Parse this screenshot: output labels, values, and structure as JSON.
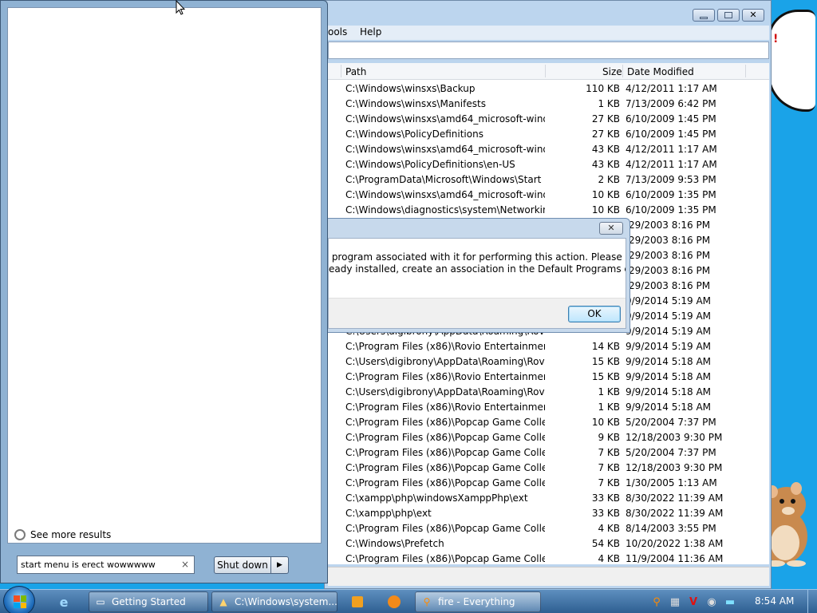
{
  "everything_window": {
    "menu_items": [
      "ools",
      "Help"
    ],
    "columns": {
      "path": "Path",
      "size": "Size",
      "date": "Date Modified"
    },
    "rows": [
      {
        "path": "C:\\Windows\\winsxs\\Backup",
        "size": "110 KB",
        "date": "4/12/2011 1:17 AM"
      },
      {
        "path": "C:\\Windows\\winsxs\\Manifests",
        "size": "1 KB",
        "date": "7/13/2009 6:42 PM"
      },
      {
        "path": "C:\\Windows\\winsxs\\amd64_microsoft-windo...",
        "size": "27 KB",
        "date": "6/10/2009 1:45 PM"
      },
      {
        "path": "C:\\Windows\\PolicyDefinitions",
        "size": "27 KB",
        "date": "6/10/2009 1:45 PM"
      },
      {
        "path": "C:\\Windows\\winsxs\\amd64_microsoft-windo...",
        "size": "43 KB",
        "date": "4/12/2011 1:17 AM"
      },
      {
        "path": "C:\\Windows\\PolicyDefinitions\\en-US",
        "size": "43 KB",
        "date": "4/12/2011 1:17 AM"
      },
      {
        "path": "C:\\ProgramData\\Microsoft\\Windows\\Start M...",
        "size": "2 KB",
        "date": "7/13/2009 9:53 PM"
      },
      {
        "path": "C:\\Windows\\winsxs\\amd64_microsoft-windo...",
        "size": "10 KB",
        "date": "6/10/2009 1:35 PM"
      },
      {
        "path": "C:\\Windows\\diagnostics\\system\\Networking",
        "size": "10 KB",
        "date": "6/10/2009 1:35 PM"
      },
      {
        "path": "",
        "size": "",
        "date": "/29/2003 8:16 PM"
      },
      {
        "path": "",
        "size": "",
        "date": "/29/2003 8:16 PM"
      },
      {
        "path": "",
        "size": "",
        "date": "/29/2003 8:16 PM"
      },
      {
        "path": "",
        "size": "",
        "date": "/29/2003 8:16 PM"
      },
      {
        "path": "",
        "size": "",
        "date": "/29/2003 8:16 PM"
      },
      {
        "path": "",
        "size": "",
        "date": "9/9/2014 5:19 AM"
      },
      {
        "path": "",
        "size": "",
        "date": "9/9/2014 5:19 AM"
      },
      {
        "path": "C:\\Users\\digibrony\\AppData\\Roaming\\Rovio...",
        "size": "",
        "date": "9/9/2014 5:19 AM"
      },
      {
        "path": "C:\\Program Files (x86)\\Rovio Entertainment L...",
        "size": "14 KB",
        "date": "9/9/2014 5:19 AM"
      },
      {
        "path": "C:\\Users\\digibrony\\AppData\\Roaming\\Rovio...",
        "size": "15 KB",
        "date": "9/9/2014 5:18 AM"
      },
      {
        "path": "C:\\Program Files (x86)\\Rovio Entertainment L...",
        "size": "15 KB",
        "date": "9/9/2014 5:18 AM"
      },
      {
        "path": "C:\\Users\\digibrony\\AppData\\Roaming\\Rovio...",
        "size": "1 KB",
        "date": "9/9/2014 5:18 AM"
      },
      {
        "path": "C:\\Program Files (x86)\\Rovio Entertainment L...",
        "size": "1 KB",
        "date": "9/9/2014 5:18 AM"
      },
      {
        "path": "C:\\Program Files (x86)\\Popcap Game Collecti...",
        "size": "10 KB",
        "date": "5/20/2004 7:37 PM"
      },
      {
        "path": "C:\\Program Files (x86)\\Popcap Game Collecti...",
        "size": "9 KB",
        "date": "12/18/2003 9:30 PM"
      },
      {
        "path": "C:\\Program Files (x86)\\Popcap Game Collecti...",
        "size": "7 KB",
        "date": "5/20/2004 7:37 PM"
      },
      {
        "path": "C:\\Program Files (x86)\\Popcap Game Collecti...",
        "size": "7 KB",
        "date": "12/18/2003 9:30 PM"
      },
      {
        "path": "C:\\Program Files (x86)\\Popcap Game Collecti...",
        "size": "7 KB",
        "date": "1/30/2005 1:13 AM"
      },
      {
        "path": "C:\\xampp\\php\\windowsXamppPhp\\ext",
        "size": "33 KB",
        "date": "8/30/2022 11:39 AM"
      },
      {
        "path": "C:\\xampp\\php\\ext",
        "size": "33 KB",
        "date": "8/30/2022 11:39 AM"
      },
      {
        "path": "C:\\Program Files (x86)\\Popcap Game Collecti...",
        "size": "4 KB",
        "date": "8/14/2003 3:55 PM"
      },
      {
        "path": "C:\\Windows\\Prefetch",
        "size": "54 KB",
        "date": "10/20/2022 1:38 AM"
      },
      {
        "path": "C:\\Program Files (x86)\\Popcap Game Collecti...",
        "size": "4 KB",
        "date": "11/9/2004 11:36 AM"
      }
    ]
  },
  "dialog": {
    "close_glyph": "✕",
    "message_line1": " program associated with it for performing this action. Please install a",
    "message_line2": "eady installed, create an association in the Default Programs control",
    "ok_label": "OK"
  },
  "start_menu": {
    "see_more_label": "See more results",
    "search_value": "start menu is erect wowwwww",
    "clear_glyph": "×",
    "shutdown_label": "Shut down",
    "shutdown_arrow": "▶"
  },
  "taskbar": {
    "buttons": [
      {
        "label": "Getting Started"
      },
      {
        "label": "C:\\Windows\\system..."
      },
      {
        "label": "fire - Everything"
      }
    ],
    "clock": "8:54 AM"
  },
  "colors": {
    "desktop": "#1aa3e8",
    "taskbar": "#2e5f91",
    "ok_button_border": "#3c7fb1"
  }
}
